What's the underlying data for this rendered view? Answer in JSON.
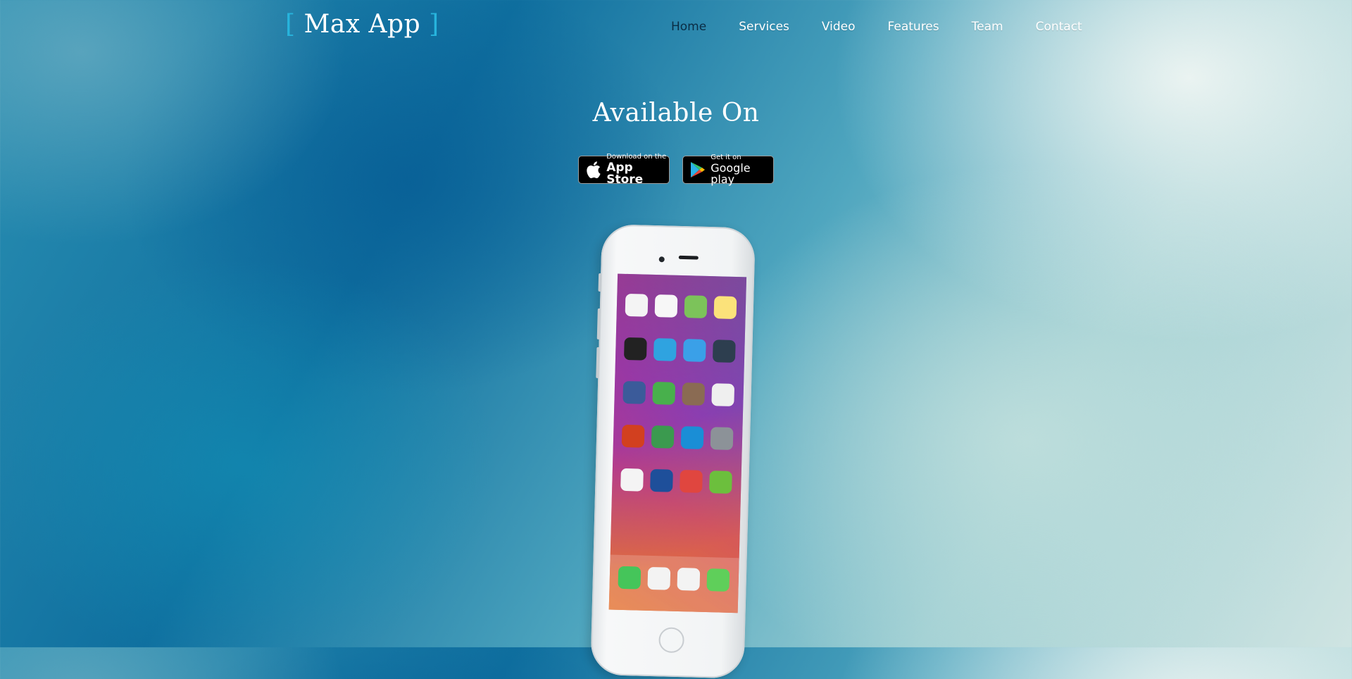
{
  "brand": {
    "open": "[",
    "name": " Max App ",
    "close": "]"
  },
  "nav": [
    {
      "label": "Home"
    },
    {
      "label": "Services"
    },
    {
      "label": "Video"
    },
    {
      "label": "Features"
    },
    {
      "label": "Team"
    },
    {
      "label": "Contact"
    }
  ],
  "hero": {
    "title": "Available On"
  },
  "stores": {
    "appstore": {
      "small": "Download on the",
      "big": "App Store"
    },
    "google": {
      "small": "Get it on",
      "big": "Google play"
    }
  },
  "colors": {
    "accent": "#27b4dd",
    "active_nav": "#0a2c44"
  }
}
